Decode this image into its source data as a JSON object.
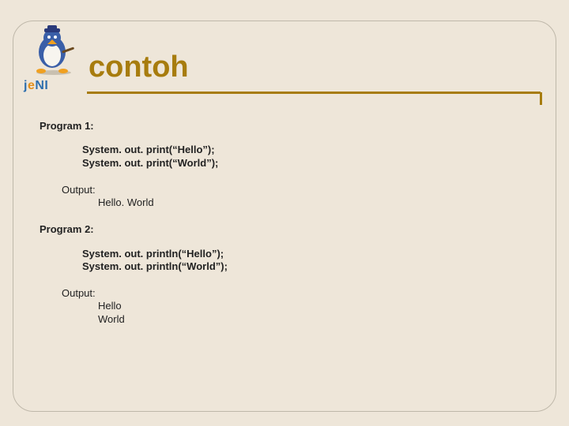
{
  "brand": {
    "wordmark_html": "j<span class=\"dot\">e</span><span class=\"ni\">NI</span>"
  },
  "title": "contoh",
  "sections": {
    "p1": {
      "heading": "Program 1:",
      "code": "System. out. print(“Hello”);\nSystem. out. print(“World”);",
      "output_label": "Output:",
      "output": "Hello. World"
    },
    "p2": {
      "heading": "Program 2:",
      "code": "System. out. println(“Hello”);\nSystem. out. println(“World”);",
      "output_label": "Output:",
      "output": "Hello\nWorld"
    }
  }
}
